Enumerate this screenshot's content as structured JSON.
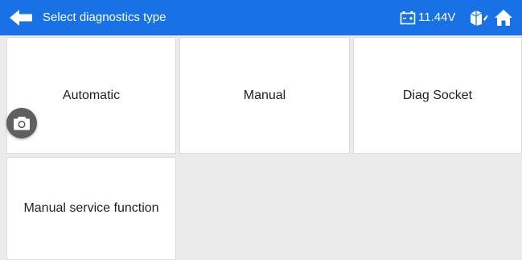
{
  "header": {
    "title": "Select diagnostics type",
    "voltage": "11.44V",
    "background_color": "#1872e6",
    "icons": [
      "back-arrow-icon",
      "battery-icon",
      "vehicle-icon",
      "home-icon"
    ]
  },
  "tiles": [
    {
      "label": "Automatic"
    },
    {
      "label": "Manual"
    },
    {
      "label": "Diag Socket"
    },
    {
      "label": "Manual service function"
    }
  ],
  "floating": {
    "icon": "camera-icon"
  }
}
